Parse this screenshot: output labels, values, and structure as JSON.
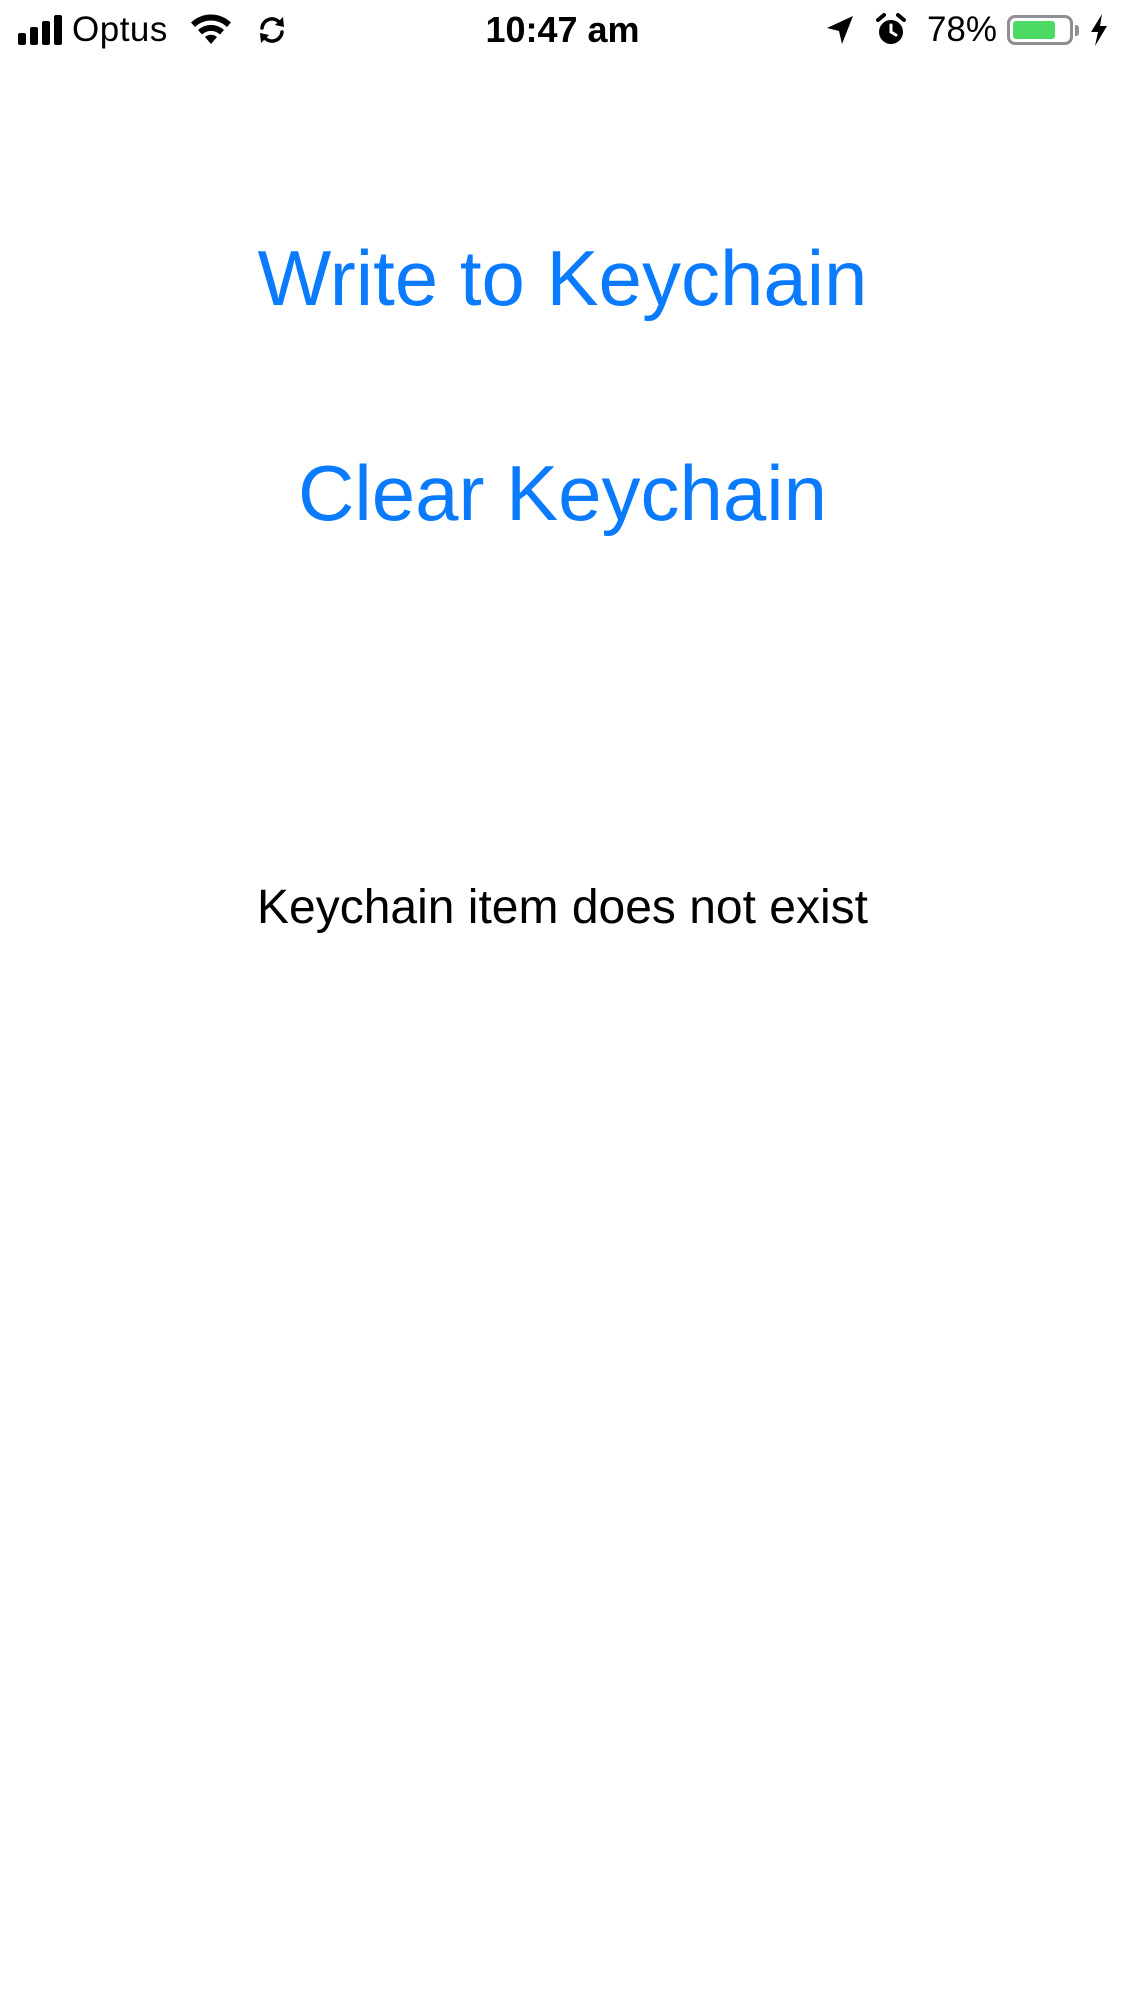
{
  "status_bar": {
    "carrier": "Optus",
    "time": "10:47 am",
    "battery_percent": "78%",
    "battery_level": 0.78,
    "signal_strength_bars": 4,
    "icons": {
      "wifi": "wifi-icon",
      "sync": "sync-icon",
      "location": "location-arrow-icon",
      "alarm": "alarm-clock-icon",
      "battery": "battery-icon",
      "charging": "charging-bolt-icon"
    },
    "colors": {
      "battery_fill": "#4cd964"
    }
  },
  "main": {
    "write_button_label": "Write to Keychain",
    "clear_button_label": "Clear Keychain",
    "status_text": "Keychain item does not exist",
    "accent_color": "#0a7aff"
  }
}
